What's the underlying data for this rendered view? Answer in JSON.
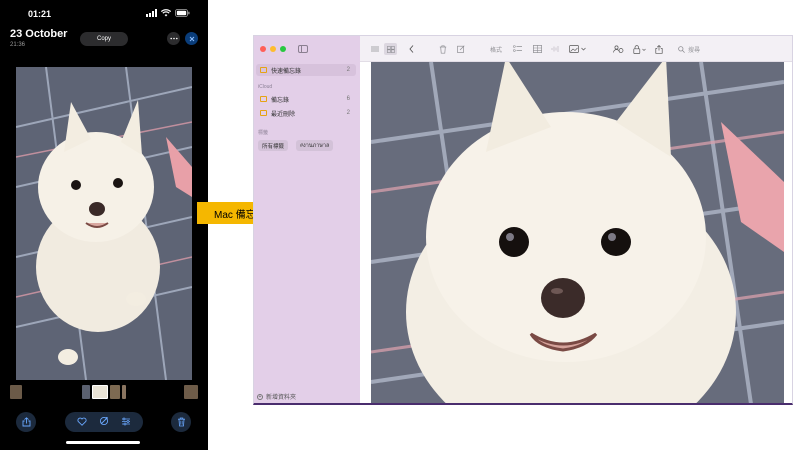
{
  "phone": {
    "status": {
      "time": "01:21"
    },
    "header": {
      "date": "23 October",
      "time": "21:36"
    },
    "copy_label": "Copy",
    "photo_subject": "white pomeranian dog on bed",
    "toolbar_icons": [
      "share-icon",
      "heart-icon",
      "magic-edit-icon",
      "adjust-icon",
      "trash-icon"
    ]
  },
  "arrow": {
    "label": "Mac 備忘錄",
    "color": "#f5b700"
  },
  "mac": {
    "sidebar": {
      "quick_notes": {
        "label": "快速備忘錄",
        "count": "2"
      },
      "icloud_label": "iCloud",
      "folders": [
        {
          "label": "備忘錄",
          "count": "6"
        },
        {
          "label": "最近刪除",
          "count": "2"
        }
      ],
      "tags_label": "標籤",
      "tags": [
        "所有標籤",
        "#งานภาษาล"
      ],
      "new_folder": "新增資料夾"
    },
    "toolbar": {
      "format_label": "格式",
      "search_placeholder": "搜尋"
    }
  },
  "colors": {
    "sidebar_bg": "#e3cfe8",
    "window_border": "#4a2d6e",
    "phone_bg": "#000000"
  }
}
